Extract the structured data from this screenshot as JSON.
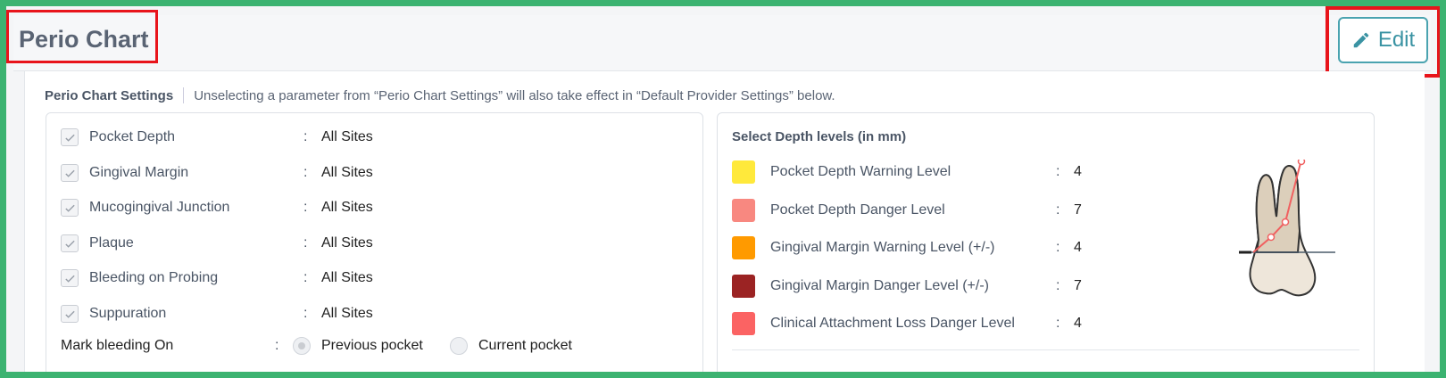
{
  "page": {
    "title": "Perio Chart",
    "edit_label": "Edit"
  },
  "settings": {
    "heading": "Perio Chart Settings",
    "note": "Unselecting a parameter from “Perio Chart Settings” will also take effect in “Default Provider Settings” below.",
    "params": [
      {
        "label": "Pocket Depth",
        "value": "All Sites",
        "checked": true
      },
      {
        "label": "Gingival Margin",
        "value": "All Sites",
        "checked": true
      },
      {
        "label": "Mucogingival Junction",
        "value": "All Sites",
        "checked": true
      },
      {
        "label": "Plaque",
        "value": "All Sites",
        "checked": true
      },
      {
        "label": "Bleeding on Probing",
        "value": "All Sites",
        "checked": true
      },
      {
        "label": "Suppuration",
        "value": "All Sites",
        "checked": true
      }
    ],
    "colon": ":",
    "mark_bleeding": {
      "label": "Mark bleeding On",
      "options": [
        "Previous pocket",
        "Current pocket"
      ],
      "selected": "Previous pocket"
    }
  },
  "depth": {
    "title": "Select Depth levels (in mm)",
    "levels": [
      {
        "label": "Pocket Depth Warning Level",
        "value": "4",
        "color": "#ffe93b"
      },
      {
        "label": "Pocket Depth Danger Level",
        "value": "7",
        "color": "#f88880"
      },
      {
        "label": "Gingival Margin Warning Level (+/-)",
        "value": "4",
        "color": "#ff9a00"
      },
      {
        "label": "Gingival Margin Danger Level (+/-)",
        "value": "7",
        "color": "#9b2323"
      },
      {
        "label": "Clinical Attachment Loss Danger Level",
        "value": "4",
        "color": "#fb6363"
      }
    ]
  },
  "icons": {
    "edit": "pencil-icon",
    "check": "check-icon",
    "tooth": "tooth-diagram-icon"
  }
}
